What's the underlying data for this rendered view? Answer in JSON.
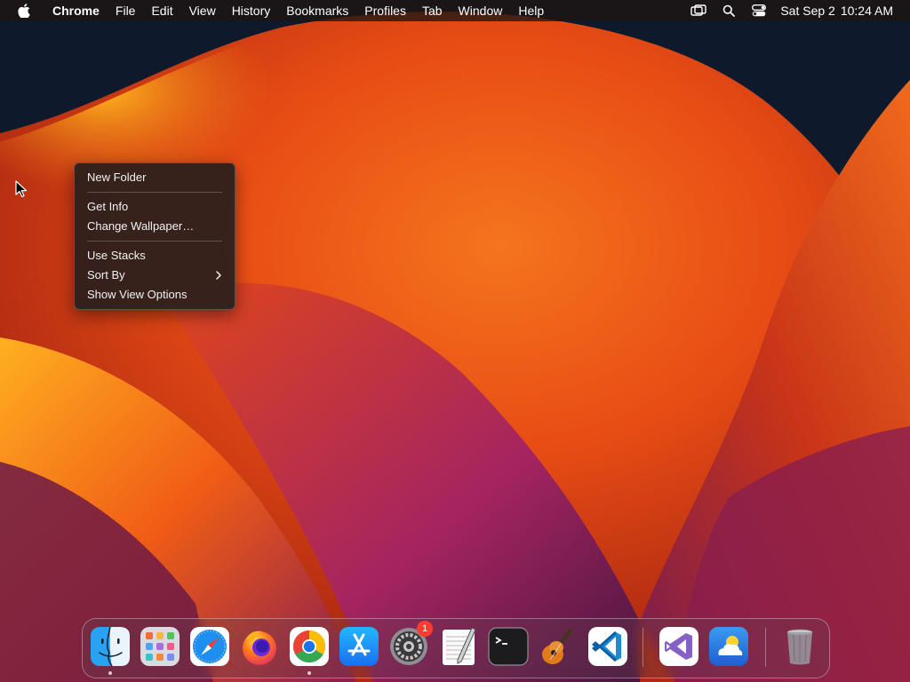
{
  "menubar": {
    "app_name": "Chrome",
    "menus": [
      "File",
      "Edit",
      "View",
      "History",
      "Bookmarks",
      "Profiles",
      "Tab",
      "Window",
      "Help"
    ],
    "date": "Sat Sep 2",
    "time": "10:24 AM",
    "status_icons": [
      "screen-mirroring-icon",
      "spotlight-search-icon",
      "control-center-icon"
    ]
  },
  "context_menu": {
    "items": {
      "new_folder": "New Folder",
      "get_info": "Get Info",
      "change_wallpaper": "Change Wallpaper…",
      "use_stacks": "Use Stacks",
      "sort_by": "Sort By",
      "show_view_options": "Show View Options"
    }
  },
  "dock": {
    "apps": [
      "Finder",
      "Launchpad",
      "Safari",
      "Firefox",
      "Google Chrome",
      "App Store",
      "System Settings",
      "TextEdit",
      "Terminal",
      "GarageBand",
      "Visual Studio Code",
      "Visual Studio",
      "Weather",
      "Trash"
    ],
    "system_settings_badge": "1",
    "running": [
      "Finder",
      "Google Chrome"
    ]
  },
  "colors": {
    "wallpaper_orange": "#f06a1c",
    "wallpaper_magenta": "#a0205a",
    "wallpaper_navy": "#0e1a2c",
    "badge_red": "#ff3b30"
  }
}
